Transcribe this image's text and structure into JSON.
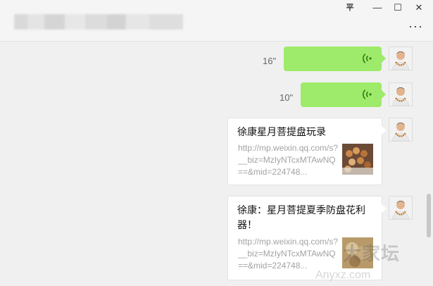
{
  "window": {
    "pin_label": "平",
    "minimize_label": "—",
    "maximize_label": "☐",
    "close_label": "✕",
    "more_label": "···"
  },
  "messages": [
    {
      "type": "voice",
      "duration": "16\""
    },
    {
      "type": "voice",
      "duration": "10\""
    },
    {
      "type": "link",
      "title": "徐康星月菩提盘玩录",
      "url": "http://mp.weixin.qq.com/s?__biz=MzIyNTcxMTAwNQ==&mid=224748..."
    },
    {
      "type": "link",
      "title": "徐康：星月菩提夏季防盘花利器！",
      "url": "http://mp.weixin.qq.com/s?__biz=MzIyNTcxMTAwNQ==&mid=224748..."
    }
  ],
  "colors": {
    "voice_bubble": "#9eea6a",
    "voice_wave": "#2f7d12"
  },
  "watermark": {
    "text": "大家坛",
    "sub": "Anyxz.com"
  }
}
